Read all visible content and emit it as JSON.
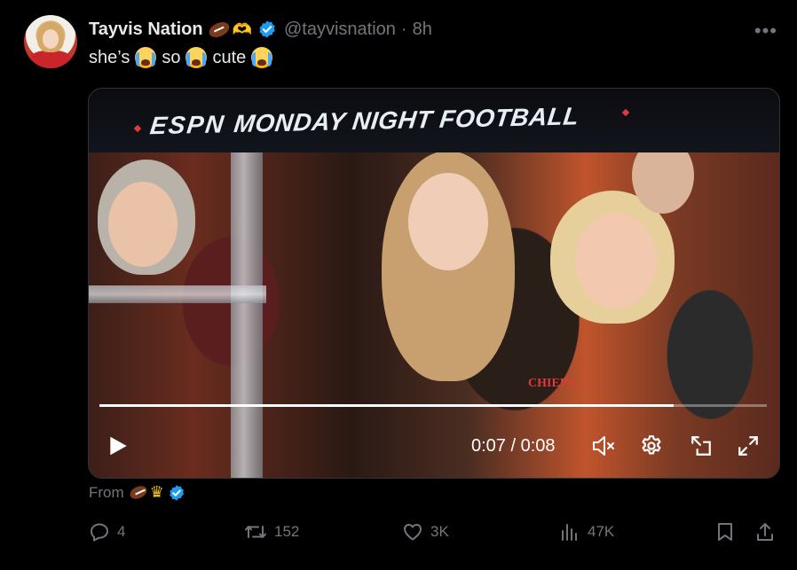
{
  "author": {
    "name": "Tayvis Nation",
    "name_emojis": [
      "football-emoji",
      "heart-hands-emoji"
    ],
    "handle": "@tayvisnation",
    "separator": "·",
    "time_ago": "8h",
    "verified": true
  },
  "tweet": {
    "text_parts": [
      "she’s",
      "so",
      "cute"
    ],
    "emoji": "loudly-crying-face"
  },
  "media": {
    "banner_text": "MONDAY NIGHT FOOTBALL",
    "banner_logo": "ESPN",
    "jersey_text": "CHIEFS",
    "time_display": "0:07 / 0:08",
    "progress": 0.86,
    "controls": [
      "play-icon",
      "mute-icon",
      "settings-icon",
      "picture-in-picture-icon",
      "fullscreen-icon"
    ]
  },
  "from": {
    "label": "From",
    "emojis": [
      "football-emoji",
      "crown-emoji"
    ],
    "verified": true
  },
  "actions": {
    "replies": "4",
    "reposts": "152",
    "likes": "3K",
    "views": "47K"
  },
  "colors": {
    "background": "#000000",
    "text_primary": "#e7e9ea",
    "text_secondary": "#71767b",
    "verified": "#1d9bf0",
    "banner_accent": "#e03a3a"
  }
}
